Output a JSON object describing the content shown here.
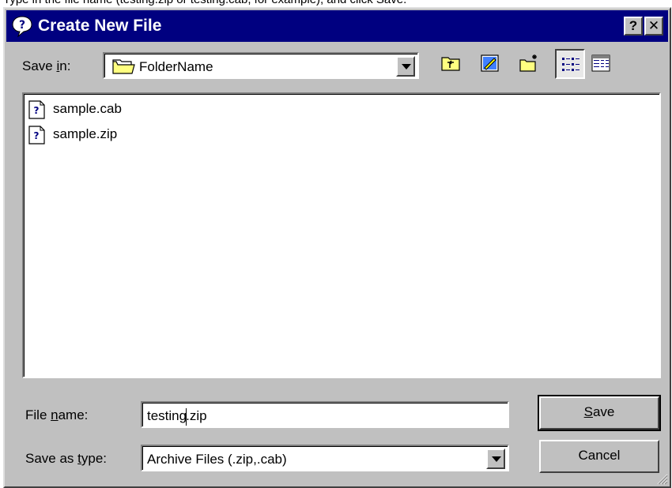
{
  "instruction": "Type in the file name (testing.zip or testing.cab, for example), and click Save.",
  "dialog": {
    "title": "Create New File",
    "help_button": "?",
    "close_button": "✕"
  },
  "save_in": {
    "label_before": "Save ",
    "label_accel": "i",
    "label_after": "n:",
    "value": "FolderName",
    "icon": "folder-icon"
  },
  "toolbar": {
    "buttons": [
      {
        "name": "up-one-level",
        "icon": "up-folder-icon"
      },
      {
        "name": "desktop",
        "icon": "desktop-icon"
      },
      {
        "name": "create-new-folder",
        "icon": "new-folder-icon"
      },
      {
        "name": "list-view",
        "icon": "list-view-icon",
        "pressed": true
      },
      {
        "name": "details-view",
        "icon": "details-view-icon",
        "pressed": false
      }
    ]
  },
  "files": [
    {
      "name": "sample.cab",
      "icon": "archive-file-icon"
    },
    {
      "name": "sample.zip",
      "icon": "archive-file-icon"
    }
  ],
  "file_name": {
    "label_before": "File ",
    "label_accel": "n",
    "label_after": "ame:",
    "value_before_caret": "testing",
    "value_after_caret": ".zip"
  },
  "save_as_type": {
    "label_before": "Save as ",
    "label_accel": "t",
    "label_after": "ype:",
    "value": "Archive Files (.zip,.cab)"
  },
  "buttons": {
    "save_accel": "S",
    "save_rest": "ave",
    "cancel": "Cancel"
  },
  "colors": {
    "titlebar": "#000080",
    "face": "#c0c0c0",
    "window": "#ffffff"
  }
}
